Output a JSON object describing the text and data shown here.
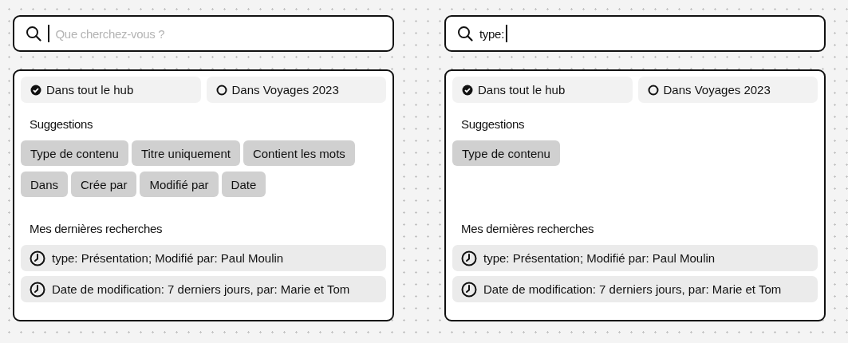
{
  "panels": [
    {
      "search": {
        "placeholder": "Que cherchez-vous ?"
      },
      "scopes": [
        {
          "label": "Dans tout le hub",
          "selected": true
        },
        {
          "label": "Dans Voyages 2023",
          "selected": false
        }
      ],
      "suggestions_title": "Suggestions",
      "suggestions": [
        "Type de contenu",
        "Titre uniquement",
        "Contient les mots",
        "Dans",
        "Crée par",
        "Modifié par",
        "Date"
      ],
      "recent_title": "Mes dernières recherches",
      "recent": [
        "type: Présentation; Modifié par: Paul Moulin",
        "Date de modification: 7 derniers jours, par: Marie et Tom"
      ]
    },
    {
      "search": {
        "value": "type:"
      },
      "scopes": [
        {
          "label": "Dans tout le hub",
          "selected": true
        },
        {
          "label": "Dans Voyages 2023",
          "selected": false
        }
      ],
      "suggestions_title": "Suggestions",
      "suggestions": [
        "Type de contenu"
      ],
      "recent_title": "Mes dernières recherches",
      "recent": [
        "type: Présentation; Modifié par: Paul Moulin",
        "Date de modification: 7 derniers jours, par: Marie et Tom"
      ]
    }
  ]
}
